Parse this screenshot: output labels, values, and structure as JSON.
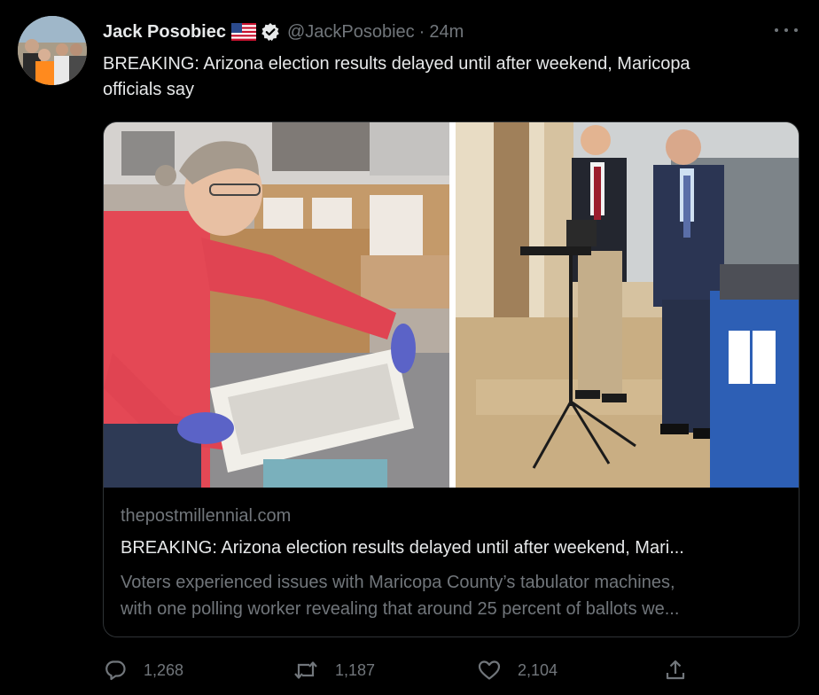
{
  "tweet": {
    "author": {
      "display_name": "Jack Posobiec",
      "handle": "@JackPosobiec",
      "flag_icon": "us-flag-icon",
      "verified_icon": "verified-badge-icon"
    },
    "time": "24m",
    "separator": "·",
    "text_lines": [
      "BREAKING: Arizona election results delayed until after weekend, Maricopa",
      "officials say"
    ],
    "card": {
      "domain": "thepostmillennial.com",
      "title": "BREAKING: Arizona election results delayed until after weekend, Mari...",
      "description_lines": [
        "Voters experienced issues with Maricopa County’s tabulator machines,",
        "with one polling worker revealing that around 25 percent of ballots we..."
      ]
    },
    "actions": {
      "replies": "1,268",
      "retweets": "1,187",
      "likes": "2,104"
    }
  },
  "colors": {
    "background": "#000000",
    "primary_text": "#e7e9ea",
    "secondary_text": "#71767b",
    "border": "#2f3336"
  }
}
